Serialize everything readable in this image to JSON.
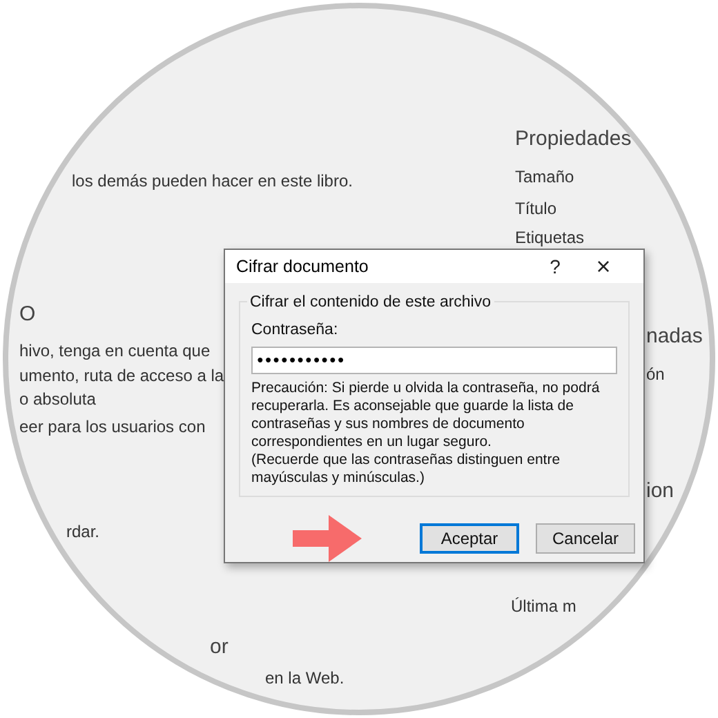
{
  "background_texts": [
    {
      "kind": "text",
      "text": "los demás pueden hacer en este libro."
    },
    {
      "kind": "heading",
      "text": "O"
    },
    {
      "kind": "text",
      "text": "hivo, tenga en cuenta que"
    },
    {
      "kind": "text",
      "text": "umento, ruta de acceso a la"
    },
    {
      "kind": "text",
      "text": "o absoluta"
    },
    {
      "kind": "text",
      "text": "eer para los usuarios con"
    },
    {
      "kind": "text",
      "text": "rdar."
    },
    {
      "kind": "heading",
      "text": "or"
    },
    {
      "kind": "text",
      "text": "en la Web."
    },
    {
      "kind": "heading",
      "text": "Propiedades"
    },
    {
      "kind": "text",
      "text": "Tamaño"
    },
    {
      "kind": "text",
      "text": "Título"
    },
    {
      "kind": "text",
      "text": "Etiquetas"
    },
    {
      "kind": "heading",
      "text": "nadas"
    },
    {
      "kind": "text",
      "text": "ón"
    },
    {
      "kind": "heading",
      "text": "ion"
    },
    {
      "kind": "text",
      "text": "Última m"
    }
  ],
  "dialog": {
    "title": "Cifrar documento",
    "help": "?",
    "close": "×",
    "group_label": "Cifrar el contenido de este archivo",
    "field_label": "Contraseña:",
    "password": "●●●●●●●●●●●",
    "warning": "Precaución: Si pierde u olvida la contraseña, no podrá recuperarla. Es aconsejable que guarde la lista de contraseñas y sus nombres de documento correspondientes en un lugar seguro.",
    "note": "(Recuerde que las contraseñas distinguen entre mayúsculas y minúsculas.)",
    "buttons": [
      {
        "label": "Aceptar",
        "selected": true
      },
      {
        "label": "Cancelar",
        "selected": false
      }
    ]
  }
}
